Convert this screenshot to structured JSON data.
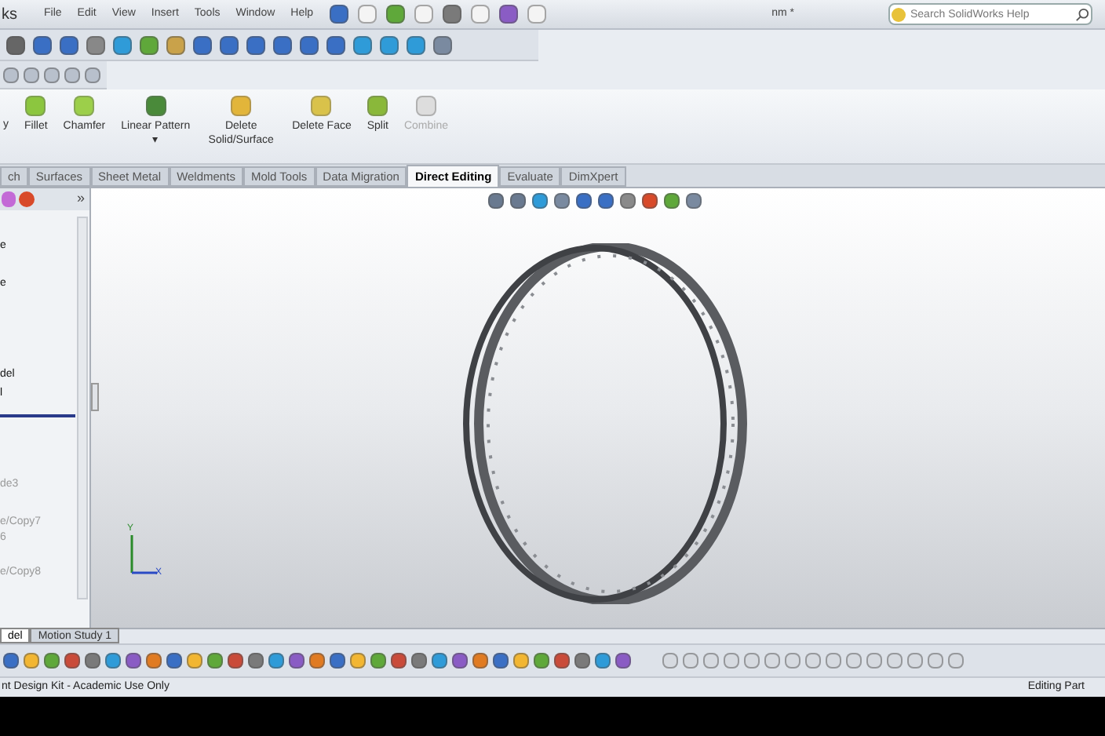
{
  "app_title": "ks",
  "menu": [
    "File",
    "Edit",
    "View",
    "Insert",
    "Tools",
    "Window",
    "Help"
  ],
  "document_title": "nm *",
  "search": {
    "placeholder": "Search SolidWorks Help"
  },
  "commands": [
    {
      "label": "y",
      "kind": "cut",
      "disabled": false
    },
    {
      "label": "Fillet",
      "kind": "fillet",
      "disabled": false
    },
    {
      "label": "Chamfer",
      "kind": "chamfer",
      "disabled": false
    },
    {
      "label": "Linear Pattern",
      "kind": "pattern",
      "disabled": false,
      "dropdown": "▾"
    },
    {
      "label": "Delete Solid/Surface",
      "kind": "delete-solid",
      "disabled": false
    },
    {
      "label": "Delete Face",
      "kind": "delete-face",
      "disabled": false
    },
    {
      "label": "Split",
      "kind": "split",
      "disabled": false
    },
    {
      "label": "Combine",
      "kind": "combine",
      "disabled": true
    }
  ],
  "tabs": [
    {
      "label": "ch",
      "selected": false
    },
    {
      "label": "Surfaces",
      "selected": false
    },
    {
      "label": "Sheet Metal",
      "selected": false
    },
    {
      "label": "Weldments",
      "selected": false
    },
    {
      "label": "Mold Tools",
      "selected": false
    },
    {
      "label": "Data Migration",
      "selected": false
    },
    {
      "label": "Direct Editing",
      "selected": true
    },
    {
      "label": "Evaluate",
      "selected": false
    },
    {
      "label": "DimXpert",
      "selected": false
    }
  ],
  "panel_expand": "»",
  "feature_tree": [
    {
      "label": "e",
      "suppressed": false
    },
    {
      "label": "e",
      "suppressed": false
    },
    {
      "label": "del",
      "suppressed": false
    },
    {
      "label": "l",
      "suppressed": false
    },
    {
      "label": "de3",
      "suppressed": true
    },
    {
      "label": "e/Copy7",
      "suppressed": true
    },
    {
      "label": "6",
      "suppressed": true
    },
    {
      "label": "e/Copy8",
      "suppressed": true
    }
  ],
  "triad": {
    "y": "Y",
    "x": "X"
  },
  "bottom_tabs": [
    {
      "label": "del",
      "selected": true
    },
    {
      "label": "Motion Study 1",
      "selected": false
    }
  ],
  "status_bar": {
    "left": "nt Design Kit - Academic Use Only",
    "right": "Editing Part"
  }
}
